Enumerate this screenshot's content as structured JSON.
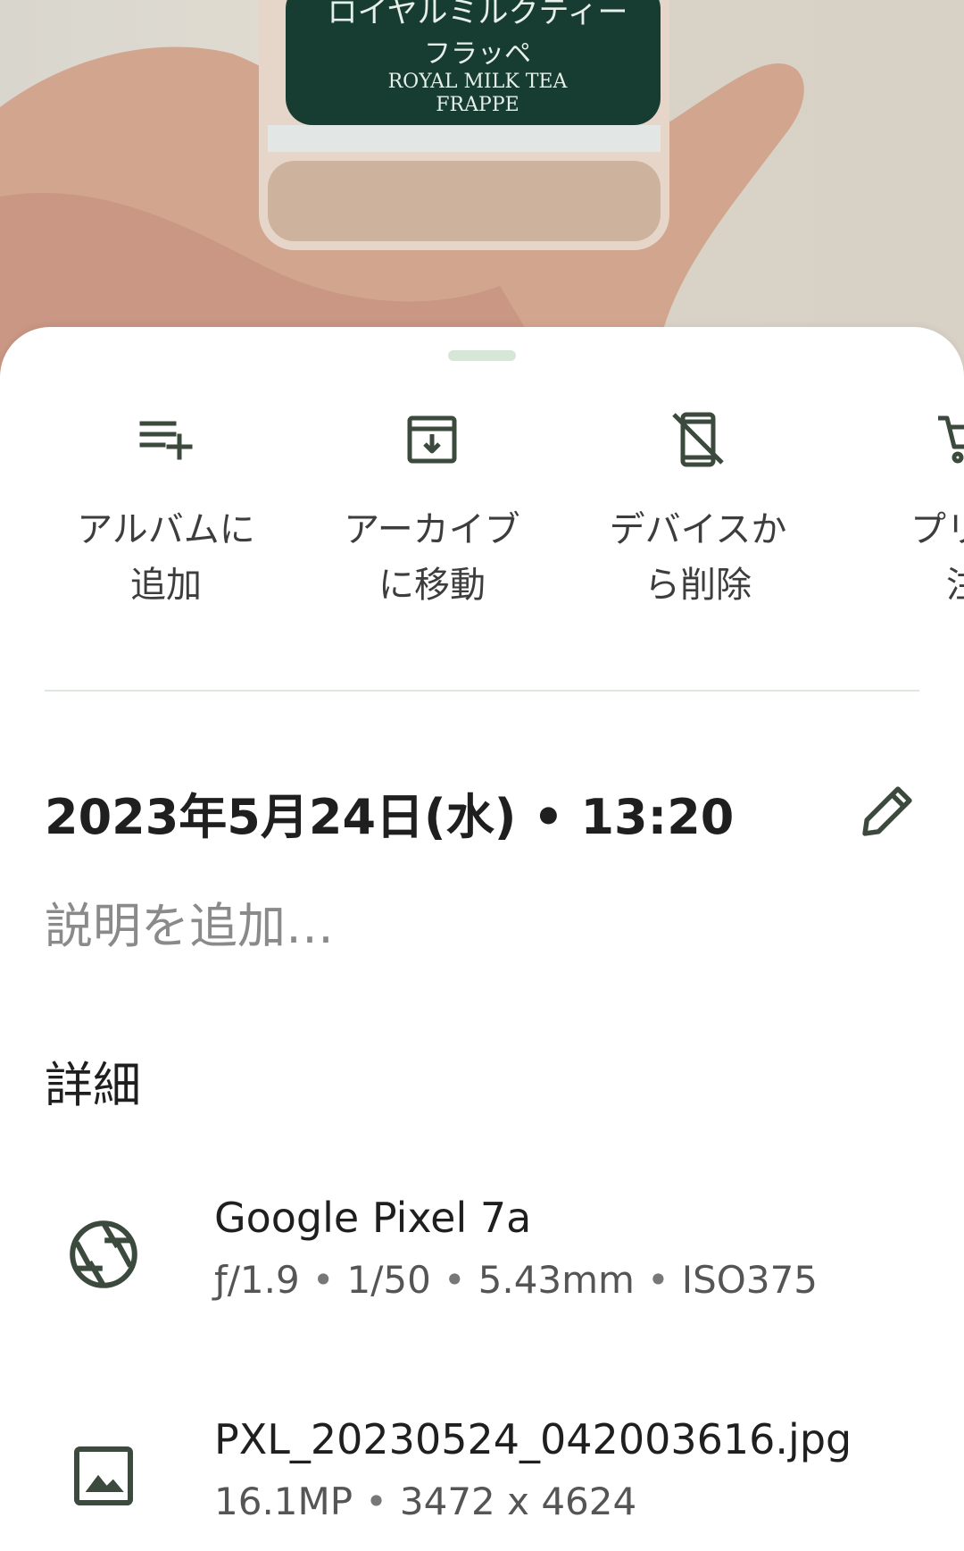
{
  "actions": [
    {
      "icon": "playlist-add-icon",
      "label": "アルバムに\n追加"
    },
    {
      "icon": "archive-icon",
      "label": "アーカイブ\nに移動"
    },
    {
      "icon": "device-delete-icon",
      "label": "デバイスか\nら削除"
    },
    {
      "icon": "cart-icon",
      "label": "プリン\n注"
    }
  ],
  "info": {
    "date": "2023年5月24日(水) • 13:20",
    "description_placeholder": "説明を追加…"
  },
  "details": {
    "title": "詳細",
    "camera": {
      "model": "Google Pixel 7a",
      "aperture": "ƒ/1.9",
      "shutter": "1/50",
      "focal": "5.43mm",
      "iso": "ISO375"
    },
    "file": {
      "name": "PXL_20230524_042003616.jpg",
      "megapixels": "16.1MP",
      "resolution": "3472 x 4624"
    }
  },
  "photo": {
    "can_text_line1": "ロイヤルミルクティー",
    "can_text_line2": "フラッペ",
    "can_text_line3": "ROYAL MILK TEA",
    "can_text_line4": "FRAPPE"
  },
  "colors": {
    "accent_handle": "#d6e6d7",
    "divider": "#dde7dd",
    "icon": "#3c4a3e",
    "text_primary": "#1f1f1f",
    "text_secondary": "#555555",
    "placeholder": "#8a8a8a"
  }
}
